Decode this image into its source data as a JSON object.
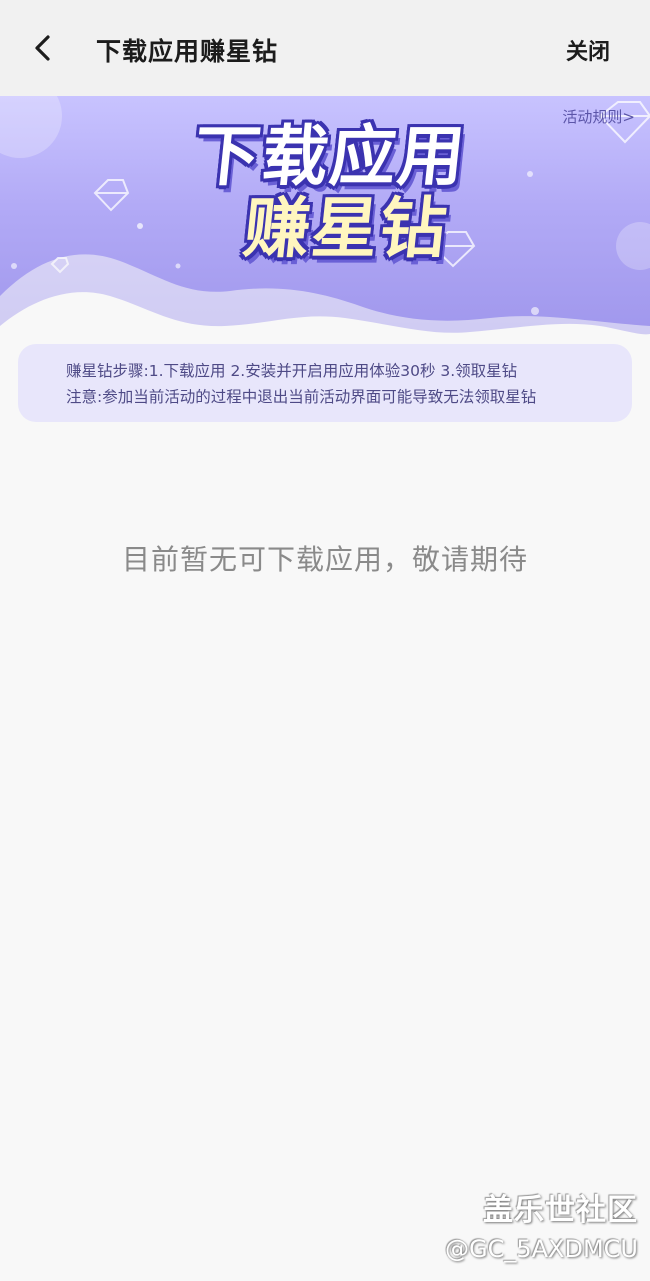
{
  "header": {
    "title": "下载应用赚星钻",
    "close_label": "关闭"
  },
  "banner": {
    "rules_link": "活动规则>",
    "title_line1": "下载应用",
    "title_line2": "赚星钻"
  },
  "info": {
    "steps": "赚星钻步骤:1.下载应用 2.安装并开启用应用体验30秒 3.领取星钻",
    "notice": "注意:参加当前活动的过程中退出当前活动界面可能导致无法领取星钻"
  },
  "empty_state": {
    "message": "目前暂无可下载应用，敬请期待"
  },
  "watermark": {
    "site": "盖乐世社区",
    "user": "@GC_5AXDMCU"
  },
  "colors": {
    "banner_top": "#c8c3ff",
    "banner_bottom": "#9f96ec",
    "card_bg": "#e8e6fb",
    "title_outline": "#3b33b0"
  }
}
